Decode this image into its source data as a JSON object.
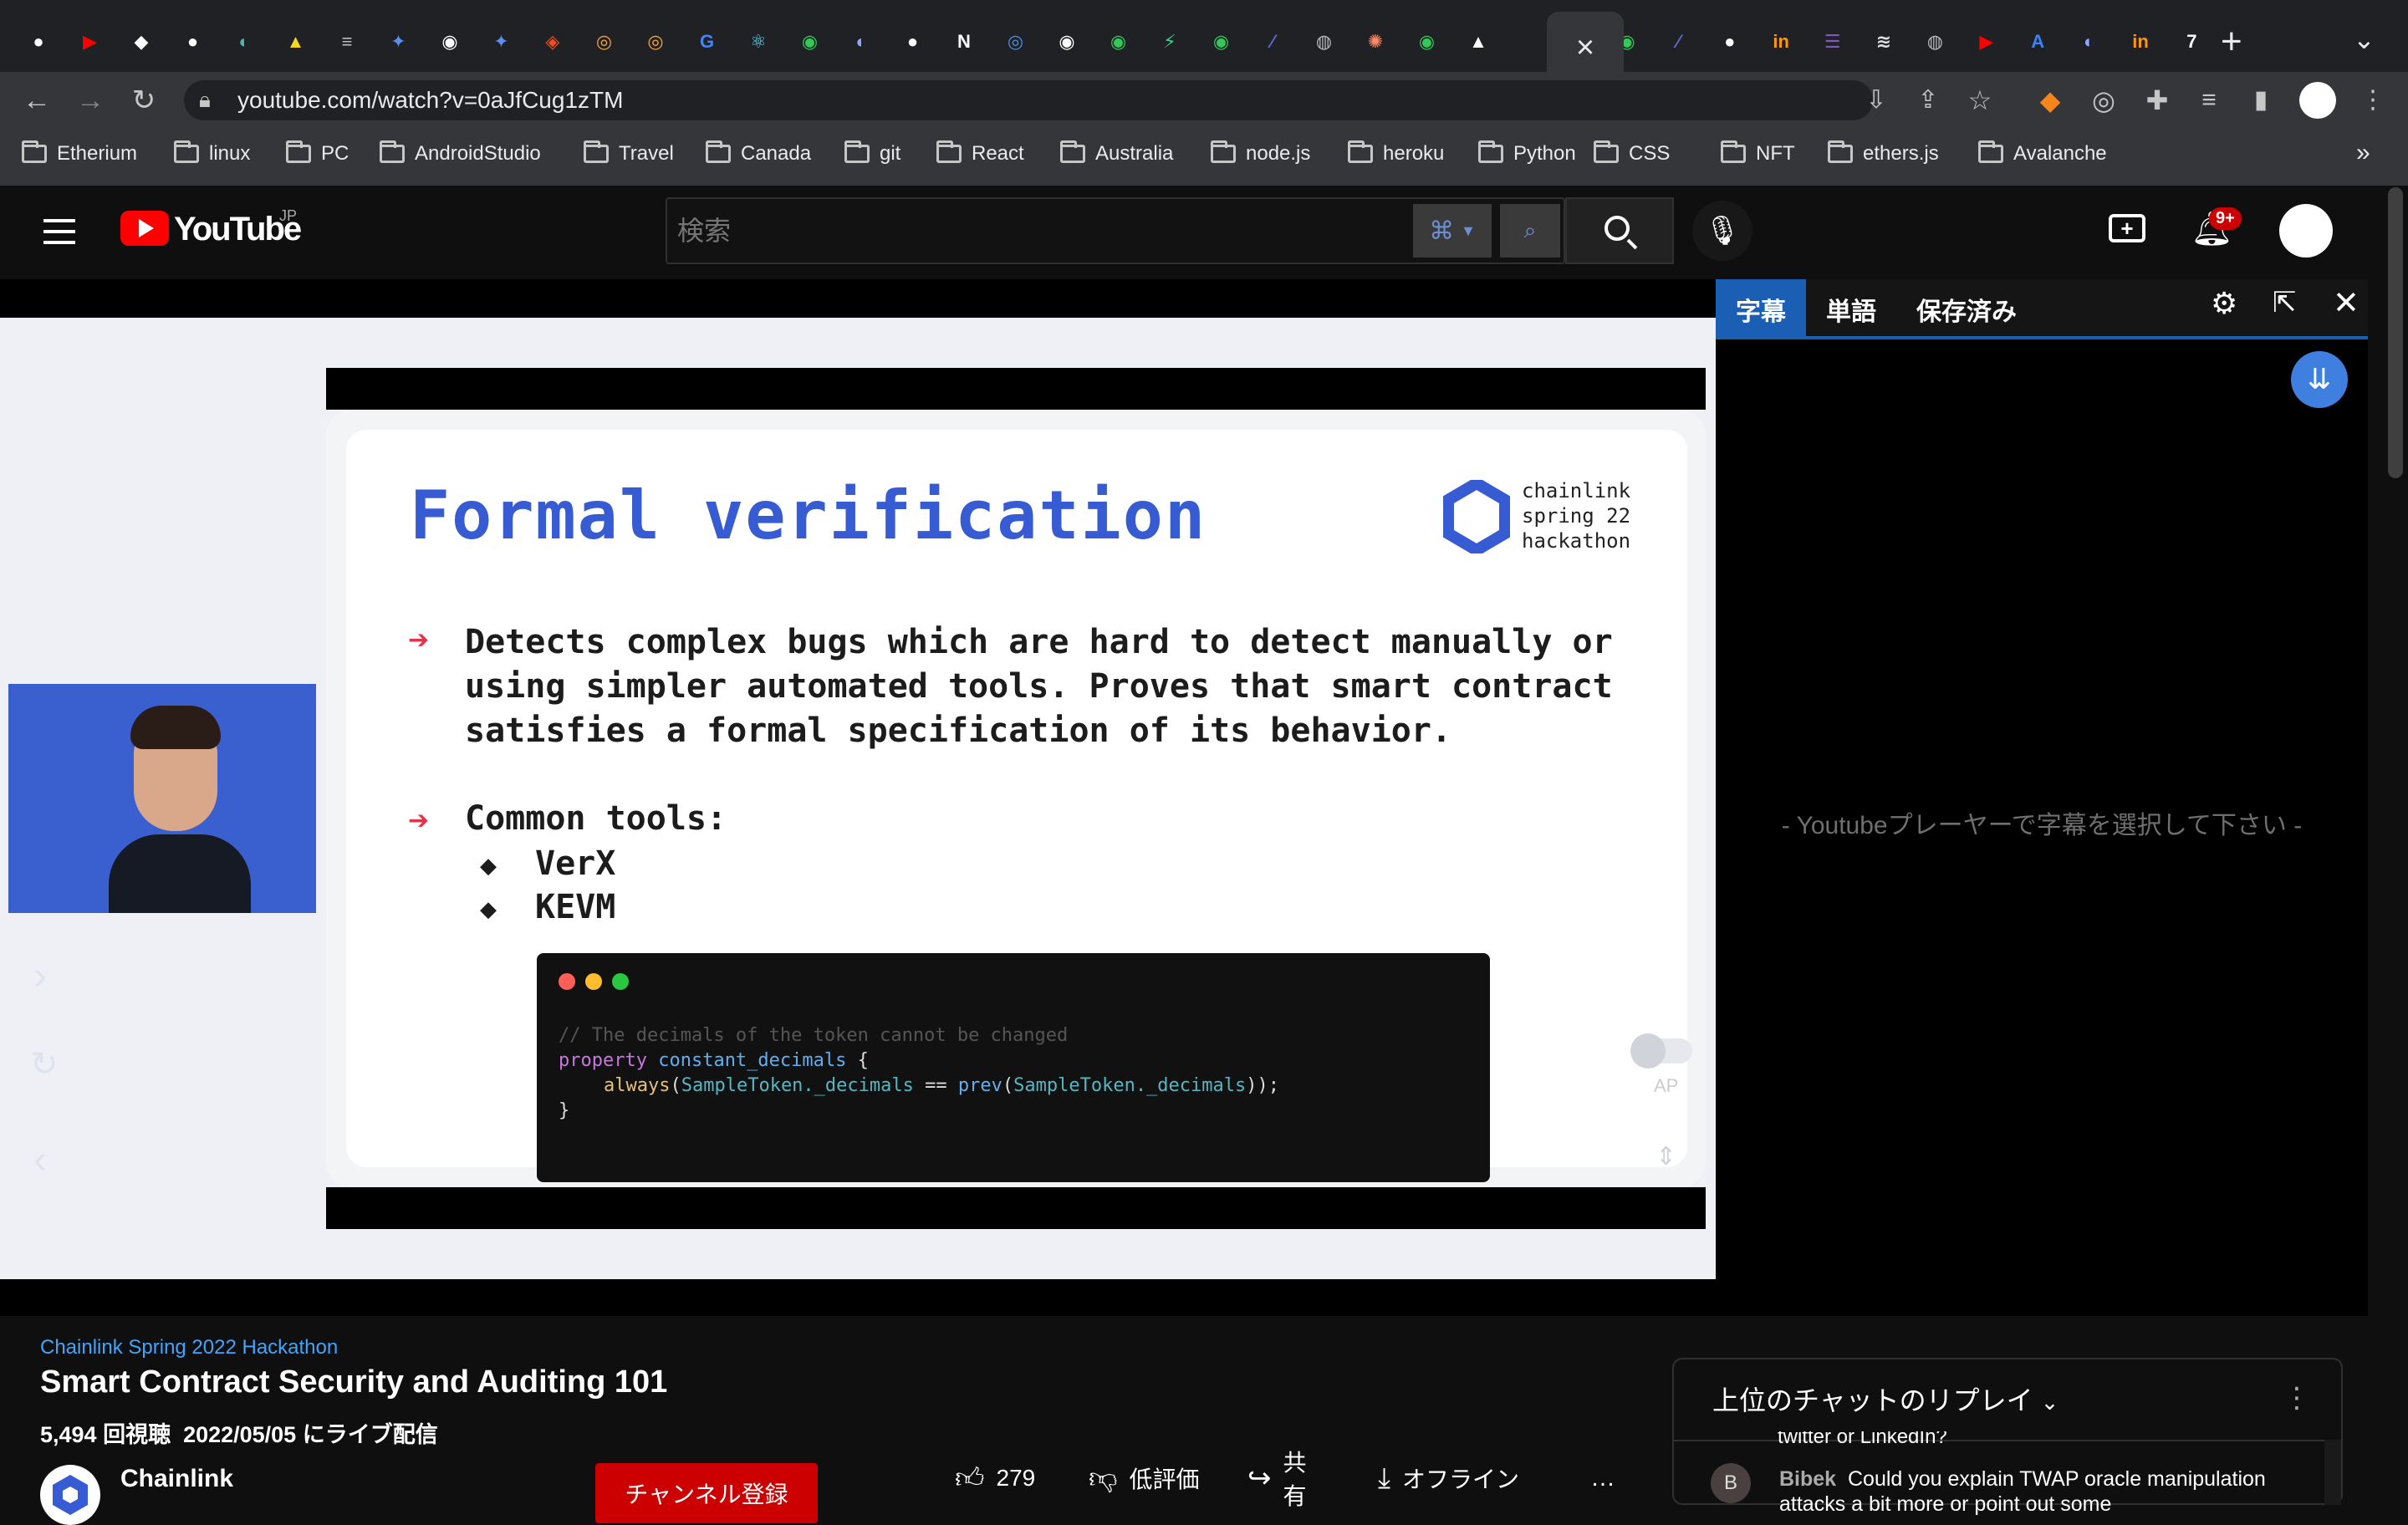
{
  "browser": {
    "url": "youtube.com/watch?v=0aJfCug1zTM",
    "tabs": [
      {
        "icon": "github-icon",
        "color": "#ffffff",
        "glyph": "●"
      },
      {
        "icon": "youtube-icon",
        "color": "#ff0000",
        "glyph": "▶"
      },
      {
        "icon": "codepen-icon",
        "color": "#ffffff",
        "glyph": "◆"
      },
      {
        "icon": "github-icon",
        "color": "#ffffff",
        "glyph": "●"
      },
      {
        "icon": "tab-icon",
        "color": "#4db6ac",
        "glyph": "◐"
      },
      {
        "icon": "warning-icon",
        "color": "#f9d71c",
        "glyph": "▲"
      },
      {
        "icon": "document-icon",
        "color": "#bdbdbd",
        "glyph": "≡"
      },
      {
        "icon": "bird-icon",
        "color": "#5b8def",
        "glyph": "✦"
      },
      {
        "icon": "chrome-icon",
        "color": "#ffffff",
        "glyph": "◉"
      },
      {
        "icon": "bird-icon",
        "color": "#5b8def",
        "glyph": "✦"
      },
      {
        "icon": "figma-icon",
        "color": "#f24e1e",
        "glyph": "◈"
      },
      {
        "icon": "donut-icon",
        "color": "#f4a340",
        "glyph": "◎"
      },
      {
        "icon": "donut-icon",
        "color": "#f4a340",
        "glyph": "◎"
      },
      {
        "icon": "google-icon",
        "color": "#4285f4",
        "glyph": "G"
      },
      {
        "icon": "react-icon",
        "color": "#61dafb",
        "glyph": "⚛"
      },
      {
        "icon": "tab-icon",
        "color": "#34c759",
        "glyph": "◉"
      },
      {
        "icon": "tab-icon",
        "color": "#8fa8ff",
        "glyph": "◐"
      },
      {
        "icon": "github-icon",
        "color": "#ffffff",
        "glyph": "●"
      },
      {
        "icon": "notion-icon",
        "color": "#ffffff",
        "glyph": "N"
      },
      {
        "icon": "compass-icon",
        "color": "#4a90e2",
        "glyph": "◎"
      },
      {
        "icon": "chrome-icon",
        "color": "#ffffff",
        "glyph": "◉"
      },
      {
        "icon": "tab-icon",
        "color": "#34c759",
        "glyph": "◉"
      },
      {
        "icon": "bolt-icon",
        "color": "#3ecf8e",
        "glyph": "⚡"
      },
      {
        "icon": "tab-icon",
        "color": "#34c759",
        "glyph": "◉"
      },
      {
        "icon": "linear-icon",
        "color": "#5e6ad2",
        "glyph": "⁄"
      },
      {
        "icon": "globe-icon",
        "color": "#bdbdbd",
        "glyph": "◍"
      },
      {
        "icon": "pinwheel-icon",
        "color": "#ff8a65",
        "glyph": "✺"
      },
      {
        "icon": "tab-icon",
        "color": "#34c759",
        "glyph": "◉"
      },
      {
        "icon": "vercel-icon",
        "color": "#ffffff",
        "glyph": "▲"
      }
    ],
    "tabs_after": [
      {
        "icon": "tab-icon",
        "color": "#34c759",
        "glyph": "◉"
      },
      {
        "icon": "linear-icon",
        "color": "#5e6ad2",
        "glyph": "⁄"
      },
      {
        "icon": "github-icon",
        "color": "#ffffff",
        "glyph": "●"
      },
      {
        "icon": "tab-icon",
        "color": "#ff9800",
        "glyph": "in"
      },
      {
        "icon": "tab-icon",
        "color": "#7e57c2",
        "glyph": "☰"
      },
      {
        "icon": "cisco-icon",
        "color": "#e0e0e0",
        "glyph": "≋"
      },
      {
        "icon": "globe-icon",
        "color": "#bdbdbd",
        "glyph": "◍"
      },
      {
        "icon": "youtube-icon",
        "color": "#ff0000",
        "glyph": "▶"
      },
      {
        "icon": "app-store-icon",
        "color": "#3b82f6",
        "glyph": "A"
      },
      {
        "icon": "tab-icon",
        "color": "#8fa8ff",
        "glyph": "◐"
      },
      {
        "icon": "tab-icon",
        "color": "#ff9800",
        "glyph": "in"
      },
      {
        "icon": "tab-icon",
        "color": "#ffffff",
        "glyph": "7"
      }
    ],
    "bookmarks": [
      "Etherium",
      "linux",
      "PC",
      "AndroidStudio",
      "Travel",
      "Canada",
      "git",
      "React",
      "Australia",
      "node.js",
      "heroku",
      "Python",
      "CSS",
      "NFT",
      "ethers.js",
      "Avalanche"
    ],
    "more_bookmarks": "»"
  },
  "youtube": {
    "logo_text": "YouTube",
    "region": "JP",
    "search_placeholder": "検索",
    "notifications": "9+",
    "video": {
      "slide_title": "Formal verification",
      "brand_lines": [
        "chainlink",
        "spring 22",
        "hackathon"
      ],
      "bullet1": "Detects complex bugs which are hard to detect manually or using simpler automated tools. Proves that smart contract satisfies a formal specification of its behavior.",
      "bullet2": "Common tools:",
      "subbullets": [
        "VerX",
        "KEVM"
      ],
      "code": {
        "comment": "// The decimals of the token cannot be changed",
        "line2_kw": "property",
        "line2_name": "constant_decimals",
        "line2_brace": "{",
        "line3_fn": "always",
        "line3_a": "SampleToken._decimals",
        "line3_op": "==",
        "line3_fn2": "prev",
        "line3_b": "SampleToken._decimals",
        "line3_end": "));",
        "line4": "}"
      },
      "overlay_ap": "AP"
    },
    "subtitle_panel": {
      "tabs": [
        "字幕",
        "単語",
        "保存済み"
      ],
      "message": "- Youtubeプレーヤーで字幕を選択して下さい -"
    },
    "meta": {
      "playlist": "Chainlink Spring 2022 Hackathon",
      "title": "Smart Contract Security and Auditing 101",
      "stats": "5,494 回視聴  2022/05/05 にライブ配信",
      "channel": "Chainlink",
      "subscribe": "チャンネル登録",
      "likes": "279",
      "dislike": "低評価",
      "share": "共有",
      "offline": "オフライン",
      "more": "…"
    },
    "chat": {
      "header": "上位のチャットのリプレイ",
      "prev_text": "twitter or LinkedIn?",
      "author_initial": "B",
      "author": "Bibek",
      "message": "Could you explain TWAP oracle manipulation attacks a bit more or point out some"
    }
  }
}
